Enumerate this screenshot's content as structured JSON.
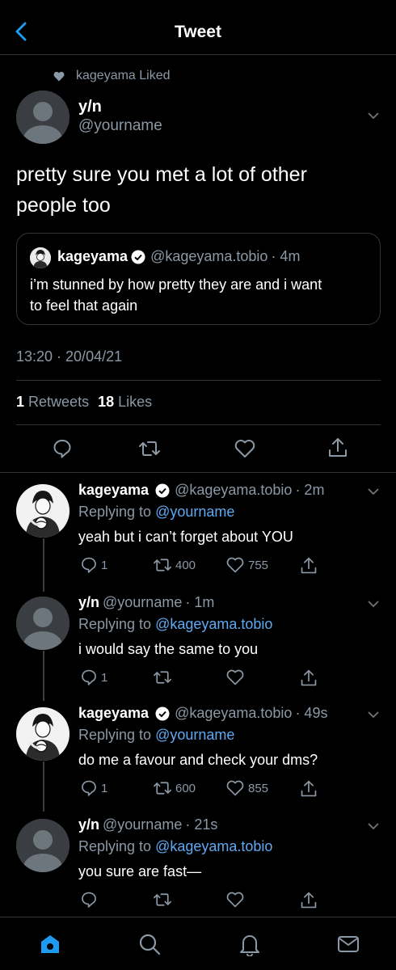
{
  "header": {
    "title": "Tweet"
  },
  "main_tweet": {
    "social_context": "kageyama Liked",
    "name": "y/n",
    "handle": "@yourname",
    "text_line1": "pretty sure you met a lot of other",
    "text_line2": "people too",
    "quote": {
      "name": "kageyama",
      "handle": "@kageyama.tobio",
      "time": "· 4m",
      "text_line1": "i’m stunned by how pretty they are and i want",
      "text_line2": "to feel that again"
    },
    "timestamp": "13:20 · 20/04/21",
    "retweets_count": "1",
    "retweets_label": "Retweets",
    "likes_count": "18",
    "likes_label": "Likes"
  },
  "replies": [
    {
      "name": "kageyama",
      "handle": "@kageyama.tobio",
      "time": "· 2m",
      "replying_prefix": "Replying to",
      "replying_to": "@yourname",
      "text": "yeah but i can’t forget about YOU",
      "reply_count": "1",
      "retweet_count": "400",
      "like_count": "755"
    },
    {
      "name": "y/n",
      "handle": "@yourname",
      "time": "· 1m",
      "replying_prefix": "Replying to",
      "replying_to": "@kageyama.tobio",
      "text": "i would say the same to you",
      "reply_count": "1",
      "retweet_count": "",
      "like_count": ""
    },
    {
      "name": "kageyama",
      "handle": "@kageyama.tobio",
      "time": "· 49s",
      "replying_prefix": "Replying to",
      "replying_to": "@yourname",
      "text": "do me a favour and check your dms?",
      "reply_count": "1",
      "retweet_count": "600",
      "like_count": "855"
    },
    {
      "name": "y/n",
      "handle": "@yourname",
      "time": "· 21s",
      "replying_prefix": "Replying to",
      "replying_to": "@kageyama.tobio",
      "text": "you sure are fast—",
      "reply_count": "",
      "retweet_count": "",
      "like_count": ""
    }
  ],
  "colors": {
    "background": "#000000",
    "accent": "#1d9bf0",
    "link": "#5ea9f2",
    "muted": "#8b98a5",
    "divider": "#2f3336"
  },
  "icons": [
    "back-arrow-icon",
    "heart-icon",
    "chevron-down-icon",
    "verified-badge-icon",
    "reply-icon",
    "retweet-icon",
    "like-icon",
    "share-icon",
    "home-icon",
    "search-icon",
    "notifications-icon",
    "messages-icon"
  ]
}
